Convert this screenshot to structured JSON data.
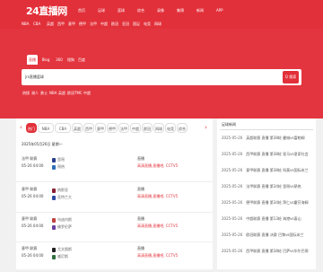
{
  "header": {
    "logo": "24直播网",
    "nav": [
      "首页",
      "足球",
      "篮球",
      "综合",
      "录像",
      "集锦",
      "新闻",
      "APP"
    ],
    "subnav": [
      "NBA",
      "CBA",
      "英超",
      "西甲",
      "意甲",
      "德甲",
      "法甲",
      "中超",
      "欧冠",
      "亚冠",
      "国足",
      "电竞",
      "网球"
    ]
  },
  "search": {
    "tabs": [
      "直播",
      "Blog",
      "360",
      "搜狗",
      "百度"
    ],
    "active_tab": 0,
    "value": "jrs直播篮球",
    "button": "Q 搜索",
    "hot": [
      "热搜",
      "湖人",
      "勇士",
      "NBA",
      "英超",
      "欧冠",
      "TMC",
      "中超"
    ]
  },
  "filter": {
    "prev": "‹",
    "next": "›",
    "items": [
      "热门",
      "NBA",
      "CBA",
      "英超",
      "西甲",
      "意甲",
      "德甲",
      "法甲",
      "中超",
      "欧冠",
      "网球",
      "电竞",
      "综合"
    ],
    "active": 0
  },
  "schedule": {
    "date": "2025年05月26日 星期一",
    "matches": [
      {
        "league": "法甲 联赛",
        "time": "05-26 04:00",
        "home": "里昂",
        "away": "昂热",
        "label": "直播",
        "channels": "高清直播,直播吧,  CCTV5",
        "home_color": "#2a3f8c",
        "away_color": "#2d6eb5"
      },
      {
        "league": "意甲 联赛",
        "time": "05-26 04:00",
        "home": "热那亚",
        "away": "亚特兰大",
        "label": "直播",
        "channels": "高清直播,直播吧,  CCTV5",
        "home_color": "#8a1e32",
        "away_color": "#2f4aa0"
      },
      {
        "league": "意甲 联赛",
        "time": "05-26 04:00",
        "home": "乌迪内斯",
        "away": "佛罗伦萨",
        "label": "直播",
        "channels": "高清直播,直播吧,  CCTV5",
        "home_color": "#c04040",
        "away_color": "#6a3fa0"
      },
      {
        "league": "意甲 联赛",
        "time": "05-26 04:00",
        "home": "尤文图斯",
        "away": "威尼斯",
        "label": "直播",
        "channels": "高清直播,直播吧,  CCTV5",
        "home_color": "#222222",
        "away_color": "#2f6f3f"
      }
    ]
  },
  "news_panel": {
    "title": "足球新闻",
    "items": [
      {
        "date": "2025-05-26",
        "text": "英超联赛 直播 第38轮 曼城vs富勒姆"
      },
      {
        "date": "2025-05-26",
        "text": "西甲联赛 直播 第38轮 皇马vs皇家社会"
      },
      {
        "date": "2025-05-26",
        "text": "意甲联赛 直播 第38轮 科莫vs国际米兰"
      },
      {
        "date": "2025-05-26",
        "text": "法甲联赛 直播 第34轮 里昂vs昂热"
      },
      {
        "date": "2025-05-26",
        "text": "德甲联赛 直播 第34轮 拜仁vs霍芬海姆"
      },
      {
        "date": "2025-05-26",
        "text": "中超联赛 直播 第13轮 海港vs泰山"
      },
      {
        "date": "2025-05-26",
        "text": "欧冠联赛 直播 决赛 巴黎vs国际米兰"
      },
      {
        "date": "2025-05-26",
        "text": "西甲联赛 直播 第38轮 巴萨vs毕尔巴鄂"
      }
    ]
  }
}
